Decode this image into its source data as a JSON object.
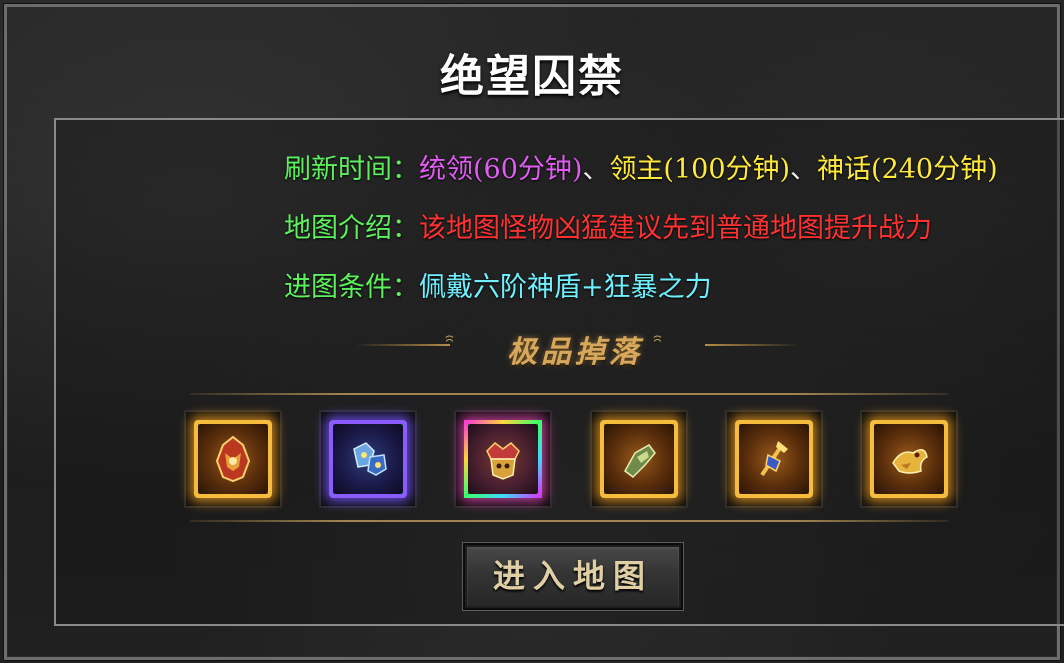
{
  "title": "绝望囚禁",
  "info": {
    "refresh": {
      "label": "刷新时间：",
      "commander": "统领(60分钟)",
      "sep1": "、",
      "lord": "领主(100分钟)",
      "sep2": "、",
      "myth": "神话(240分钟)"
    },
    "intro": {
      "label": "地图介绍：",
      "text": "该地图怪物凶猛建议先到普通地图提升战力"
    },
    "condition": {
      "label": "进图条件：",
      "text": "佩戴六阶神盾+狂暴之力"
    }
  },
  "drops": {
    "title": "极品掉落",
    "items": [
      {
        "icon": "dragon-helmet-icon",
        "frame": "gold"
      },
      {
        "icon": "armor-set-icon",
        "frame": "purple"
      },
      {
        "icon": "crowned-beast-icon",
        "frame": "rainbow"
      },
      {
        "icon": "jade-gauntlet-icon",
        "frame": "gold"
      },
      {
        "icon": "golden-trident-icon",
        "frame": "gold"
      },
      {
        "icon": "golden-dragon-icon",
        "frame": "gold"
      }
    ]
  },
  "enter_button": "进入地图",
  "colors": {
    "label": "#5df05d",
    "commander": "#e05cf2",
    "lord": "#ffea3a",
    "warning": "#ff3131",
    "condition": "#6ff0ff",
    "drops_title": "#d7a85b"
  }
}
